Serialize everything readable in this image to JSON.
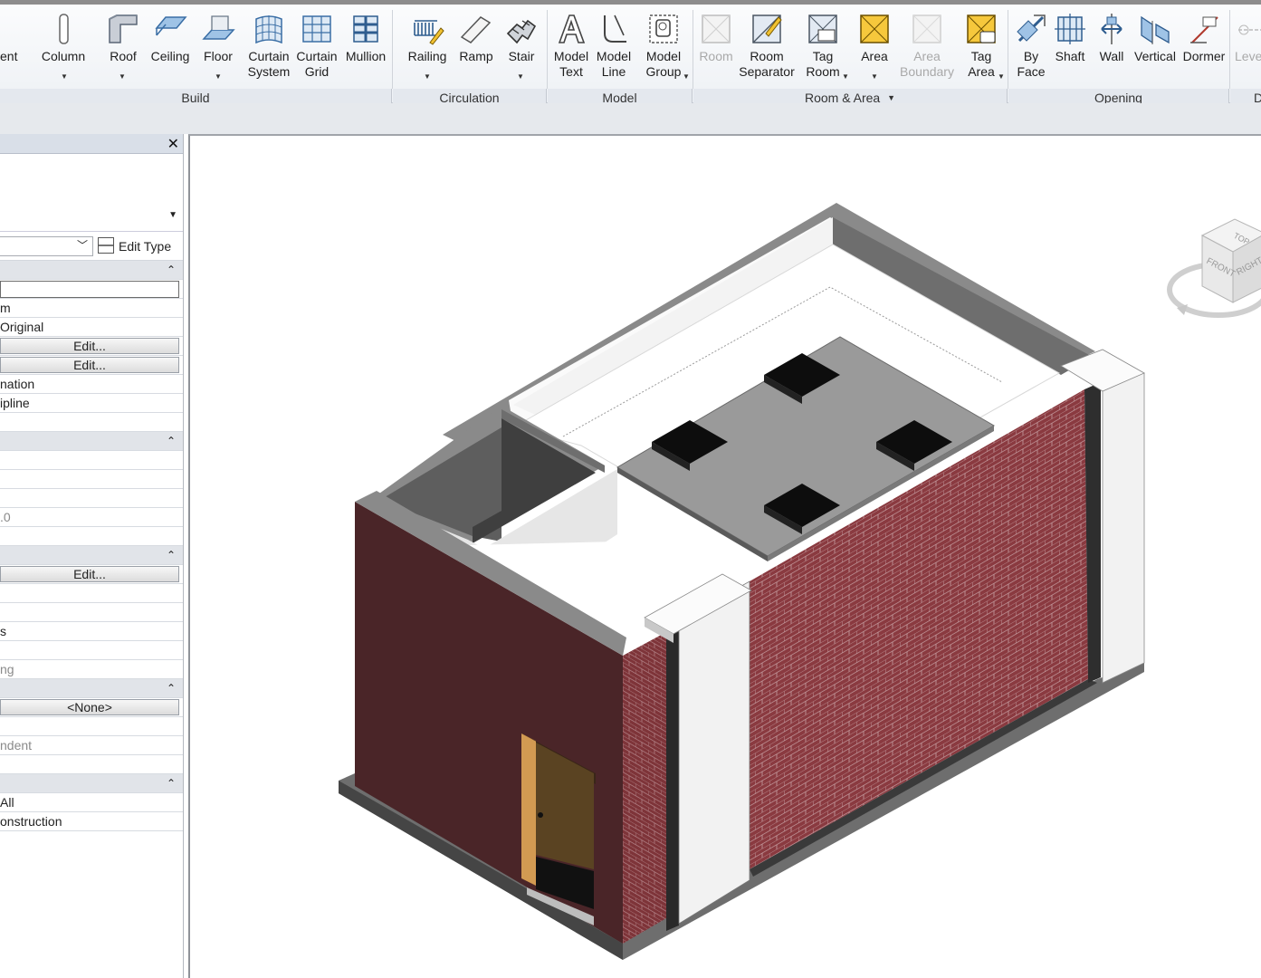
{
  "ribbon": {
    "buttons": {
      "component": "ent",
      "column": "Column",
      "roof": "Roof",
      "ceiling": "Ceiling",
      "floor": "Floor",
      "curtain_system": "Curtain\nSystem",
      "curtain_grid": "Curtain\nGrid",
      "mullion": "Mullion",
      "railing": "Railing",
      "ramp": "Ramp",
      "stair": "Stair",
      "model_text": "Model\nText",
      "model_line": "Model\nLine",
      "model_group": "Model\nGroup",
      "room": "Room",
      "room_separator": "Room\nSeparator",
      "tag_room": "Tag\nRoom",
      "area": "Area",
      "area_boundary": "Area\nBoundary",
      "tag_area": "Tag\nArea",
      "by_face": "By\nFace",
      "shaft": "Shaft",
      "wall": "Wall",
      "vertical": "Vertical",
      "dormer": "Dormer",
      "level": "Leve"
    },
    "panels": {
      "build": "Build",
      "circulation": "Circulation",
      "model": "Model",
      "room_area": "Room & Area",
      "opening": "Opening",
      "datum": "D"
    }
  },
  "properties": {
    "close_glyph": "✕",
    "edit_type": "Edit Type",
    "rows": [
      {
        "kind": "group",
        "text": ""
      },
      {
        "kind": "input",
        "text": ""
      },
      {
        "kind": "value",
        "text": "m"
      },
      {
        "kind": "value",
        "text": "Original"
      },
      {
        "kind": "button",
        "text": "Edit..."
      },
      {
        "kind": "button",
        "text": "Edit..."
      },
      {
        "kind": "value",
        "text": "nation"
      },
      {
        "kind": "value",
        "text": "ipline"
      },
      {
        "kind": "value",
        "text": ""
      },
      {
        "kind": "group",
        "text": ""
      },
      {
        "kind": "value",
        "text": ""
      },
      {
        "kind": "value",
        "text": ""
      },
      {
        "kind": "value",
        "text": ""
      },
      {
        "kind": "gray",
        "text": ".0"
      },
      {
        "kind": "value",
        "text": ""
      },
      {
        "kind": "group",
        "text": ""
      },
      {
        "kind": "button",
        "text": "Edit..."
      },
      {
        "kind": "value",
        "text": ""
      },
      {
        "kind": "value",
        "text": ""
      },
      {
        "kind": "value",
        "text": "s"
      },
      {
        "kind": "value",
        "text": ""
      },
      {
        "kind": "gray",
        "text": "ng"
      },
      {
        "kind": "group",
        "text": ""
      },
      {
        "kind": "button",
        "text": "<None>"
      },
      {
        "kind": "value",
        "text": ""
      },
      {
        "kind": "gray",
        "text": "ndent"
      },
      {
        "kind": "value",
        "text": ""
      },
      {
        "kind": "group",
        "text": ""
      },
      {
        "kind": "value",
        "text": "All"
      },
      {
        "kind": "value",
        "text": "onstruction"
      }
    ]
  },
  "viewcube": {
    "top": "TOP",
    "front": "FRONT",
    "right": "RIGHT"
  },
  "colors": {
    "brick": "#8a3a40",
    "wall_dark": "#4a2528",
    "pilaster": "#f2f2f2",
    "door": "#5a4322",
    "roof_slab": "#9a9a9a"
  }
}
